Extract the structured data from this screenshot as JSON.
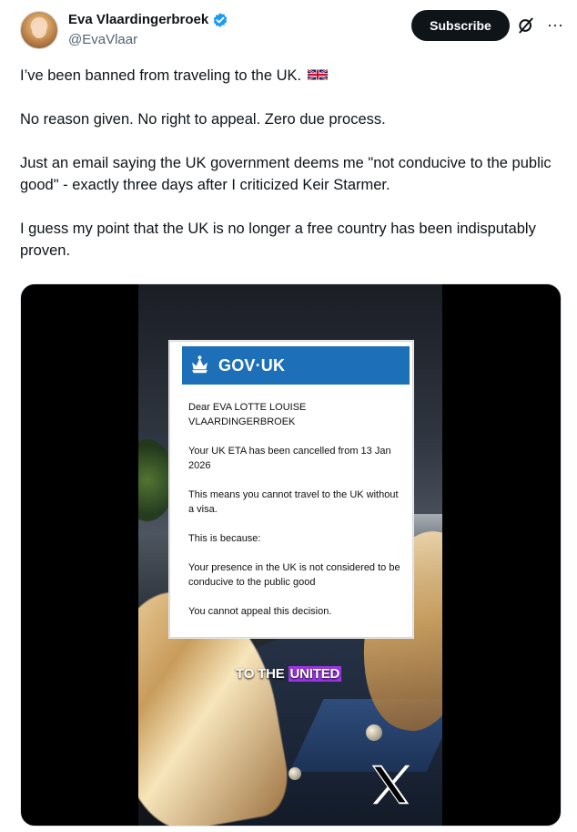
{
  "author": {
    "display_name": "Eva Vlaardingerbroek",
    "handle": "@EvaVlaar"
  },
  "actions": {
    "subscribe_label": "Subscribe",
    "more_label": "···"
  },
  "tweet": {
    "paragraphs": [
      "I’ve been banned from traveling to the UK.",
      "No reason given. No right to appeal. Zero due process.",
      "Just an email saying the UK government deems me \"not conducive to the public good\" - exactly three days after I  criticized Keir Starmer.",
      "I guess my point that the UK is no longer a free country has been indisputably proven."
    ]
  },
  "media": {
    "gov_title": "GOV·UK",
    "notice_lines": [
      "Dear EVA LOTTE LOUISE VLAARDINGERBROEK",
      "Your UK ETA has been cancelled from 13 Jan 2026",
      "This means you cannot travel to the UK without a visa.",
      "This is because:",
      "Your presence in the UK is not considered to be conducive to the public good",
      "You cannot appeal this decision."
    ],
    "caption_prefix": "TO THE ",
    "caption_highlight": "UNITED"
  },
  "colors": {
    "text": "#0f1419",
    "handle": "#536471",
    "verified": "#1d9bf0",
    "gov_blue": "#1d70b8",
    "caption_highlight": "#9b37e6"
  },
  "icons": {
    "verified": "verified-badge-icon",
    "grok": "grok-icon",
    "flag": "uk-flag-icon",
    "crown": "gov-crown-icon",
    "watermark": "x-logo-icon"
  }
}
